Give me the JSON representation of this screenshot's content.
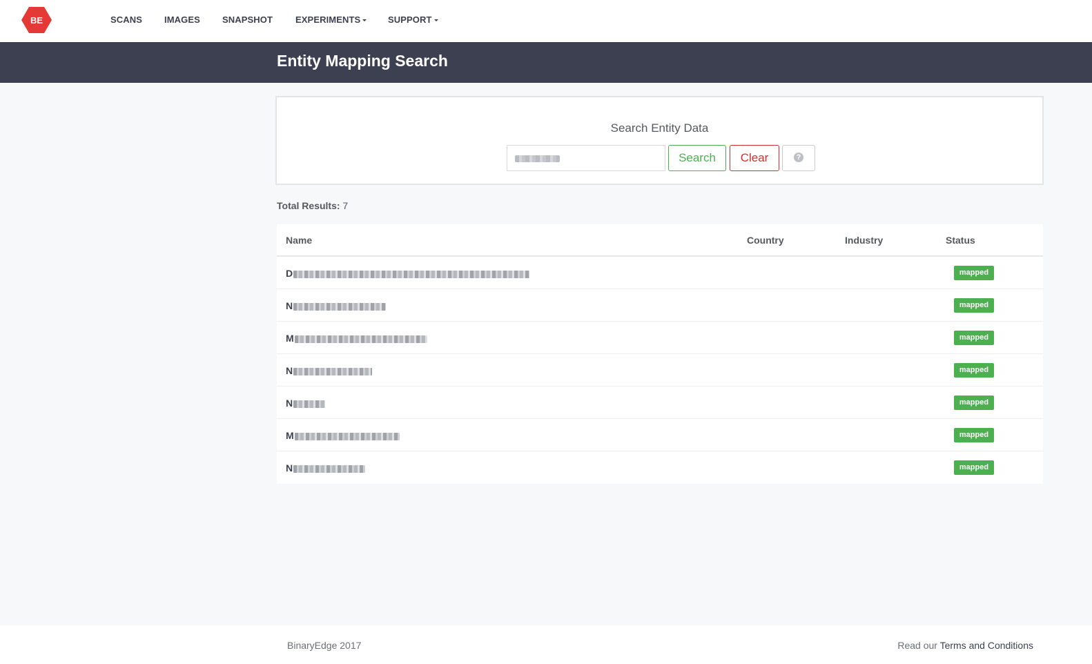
{
  "nav": {
    "logo_text": "BE",
    "items": [
      {
        "label": "SCANS",
        "dropdown": false
      },
      {
        "label": "IMAGES",
        "dropdown": false
      },
      {
        "label": "SNAPSHOT",
        "dropdown": false
      },
      {
        "label": "EXPERIMENTS",
        "dropdown": true
      },
      {
        "label": "SUPPORT",
        "dropdown": true
      }
    ]
  },
  "header": {
    "title": "Entity Mapping Search"
  },
  "search": {
    "heading": "Search Entity Data",
    "input_value": "",
    "search_label": "Search",
    "clear_label": "Clear",
    "help_icon": "question-circle-icon"
  },
  "results": {
    "total_label": "Total Results:",
    "total_count": "7",
    "columns": {
      "name": "Name",
      "country": "Country",
      "industry": "Industry",
      "status": "Status"
    },
    "rows": [
      {
        "name_initial": "D",
        "country": "",
        "industry": "",
        "status": "mapped"
      },
      {
        "name_initial": "N",
        "country": "",
        "industry": "",
        "status": "mapped"
      },
      {
        "name_initial": "M",
        "country": "",
        "industry": "",
        "status": "mapped"
      },
      {
        "name_initial": "N",
        "country": "",
        "industry": "",
        "status": "mapped"
      },
      {
        "name_initial": "N",
        "country": "",
        "industry": "",
        "status": "mapped"
      },
      {
        "name_initial": "M",
        "country": "",
        "industry": "",
        "status": "mapped"
      },
      {
        "name_initial": "N",
        "country": "",
        "industry": "",
        "status": "mapped"
      }
    ]
  },
  "footer": {
    "copyright": "BinaryEdge 2017",
    "terms_prefix": "Read our",
    "terms_link": "Terms and Conditions"
  },
  "colors": {
    "accent_red": "#e53935",
    "header_bg": "#3d4051",
    "success_green": "#4caf50",
    "danger_red": "#d32f2f"
  }
}
